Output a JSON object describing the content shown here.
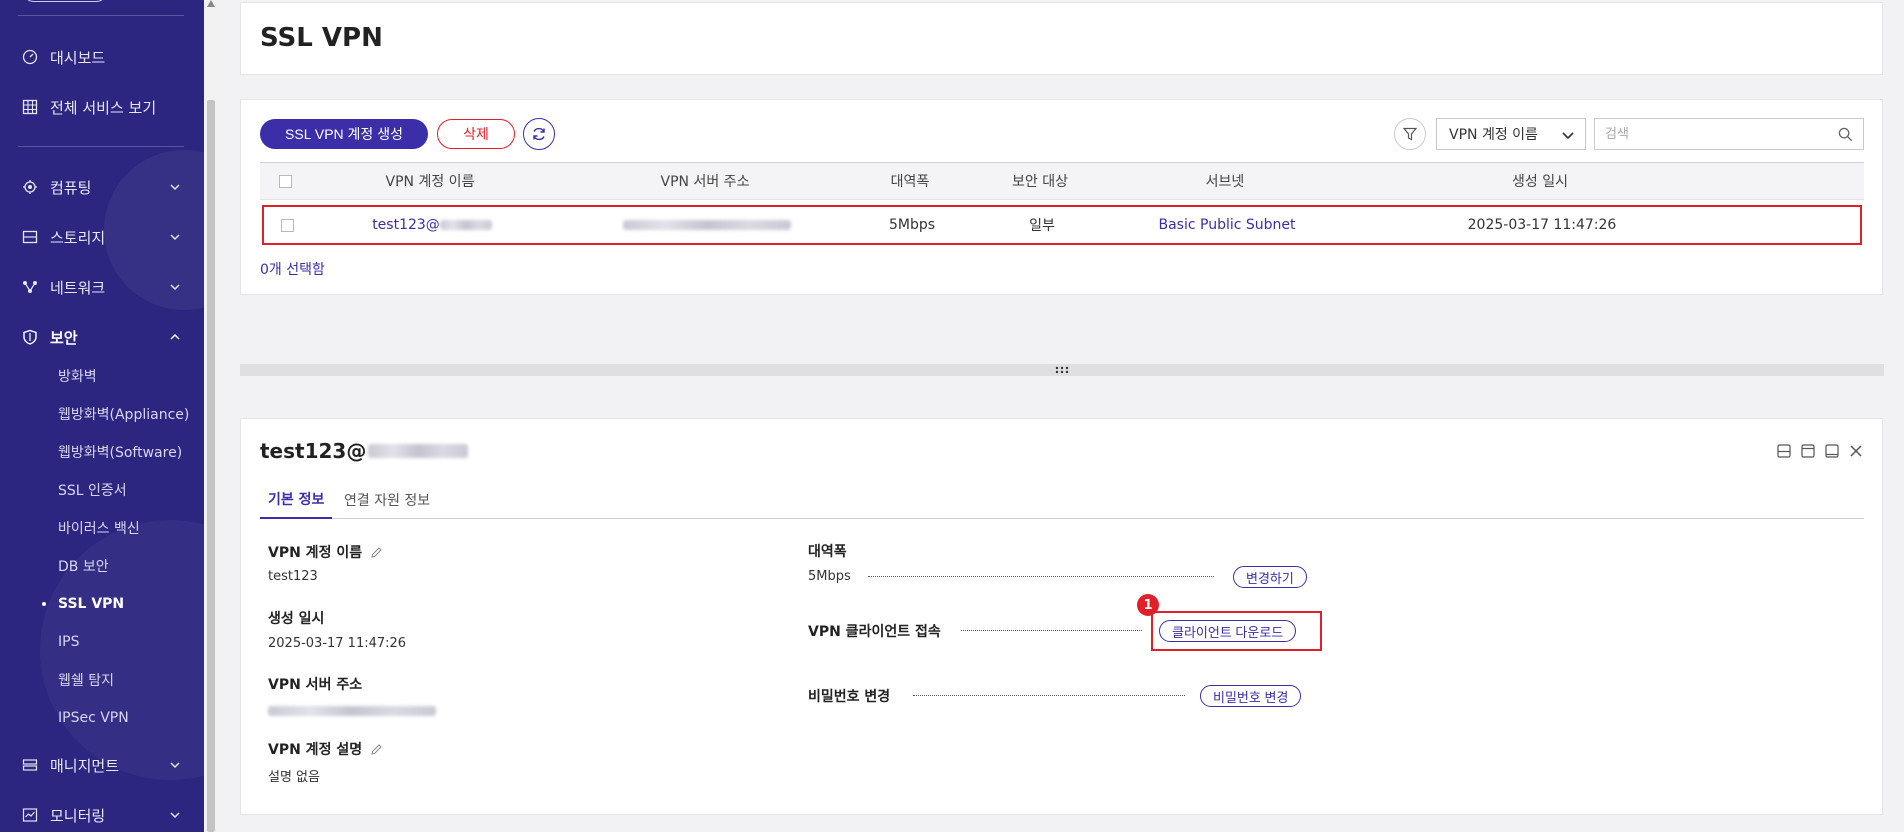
{
  "sidebar": {
    "items": [
      {
        "label": "대시보드",
        "icon": "dashboard-icon"
      },
      {
        "label": "전체 서비스 보기",
        "icon": "grid-icon"
      },
      {
        "label": "컴퓨팅",
        "icon": "cpu-icon"
      },
      {
        "label": "스토리지",
        "icon": "storage-icon"
      },
      {
        "label": "네트워크",
        "icon": "network-icon"
      },
      {
        "label": "보안",
        "icon": "shield-icon"
      },
      {
        "label": "매니지먼트",
        "icon": "management-icon"
      },
      {
        "label": "모니터링",
        "icon": "monitoring-icon"
      }
    ],
    "security_sub": [
      "방화벽",
      "웹방화벽(Appliance)",
      "웹방화벽(Software)",
      "SSL 인증서",
      "바이러스 백신",
      "DB 보안",
      "SSL VPN",
      "IPS",
      "웹쉘 탐지",
      "IPSec VPN"
    ],
    "current_sub": "SSL VPN"
  },
  "page": {
    "title": "SSL VPN"
  },
  "toolbar": {
    "create_label": "SSL VPN 계정 생성",
    "delete_label": "삭제",
    "select_value": "VPN 계정 이름",
    "search_placeholder": "검색"
  },
  "table": {
    "columns": [
      "VPN 계정 이름",
      "VPN 서버 주소",
      "대역폭",
      "보안 대상",
      "서브넷",
      "생성 일시"
    ],
    "rows": [
      {
        "name": "test123@",
        "server": "",
        "bandwidth": "5Mbps",
        "target": "일부",
        "subnet": "Basic Public Subnet",
        "created": "2025-03-17 11:47:26"
      }
    ],
    "selected_count": "0개 선택함"
  },
  "detail": {
    "title": "test123@",
    "tabs": [
      "기본 정보",
      "연결 자원 정보"
    ],
    "fields": {
      "account_name_label": "VPN 계정 이름",
      "account_name_value": "test123",
      "created_label": "생성 일시",
      "created_value": "2025-03-17 11:47:26",
      "server_label": "VPN 서버 주소",
      "description_label": "VPN 계정 설명",
      "description_value": "설명 없음",
      "bandwidth_label": "대역폭",
      "bandwidth_value": "5Mbps",
      "client_label": "VPN 클라이언트 접속",
      "password_label": "비밀번호 변경"
    },
    "buttons": {
      "change": "변경하기",
      "client_download": "클라이언트 다운로드",
      "password_change": "비밀번호 변경"
    },
    "badge": "1"
  },
  "colors": {
    "sidebar_bg": "#2d2680",
    "accent": "#3c2ea8",
    "danger": "#e0202a"
  }
}
